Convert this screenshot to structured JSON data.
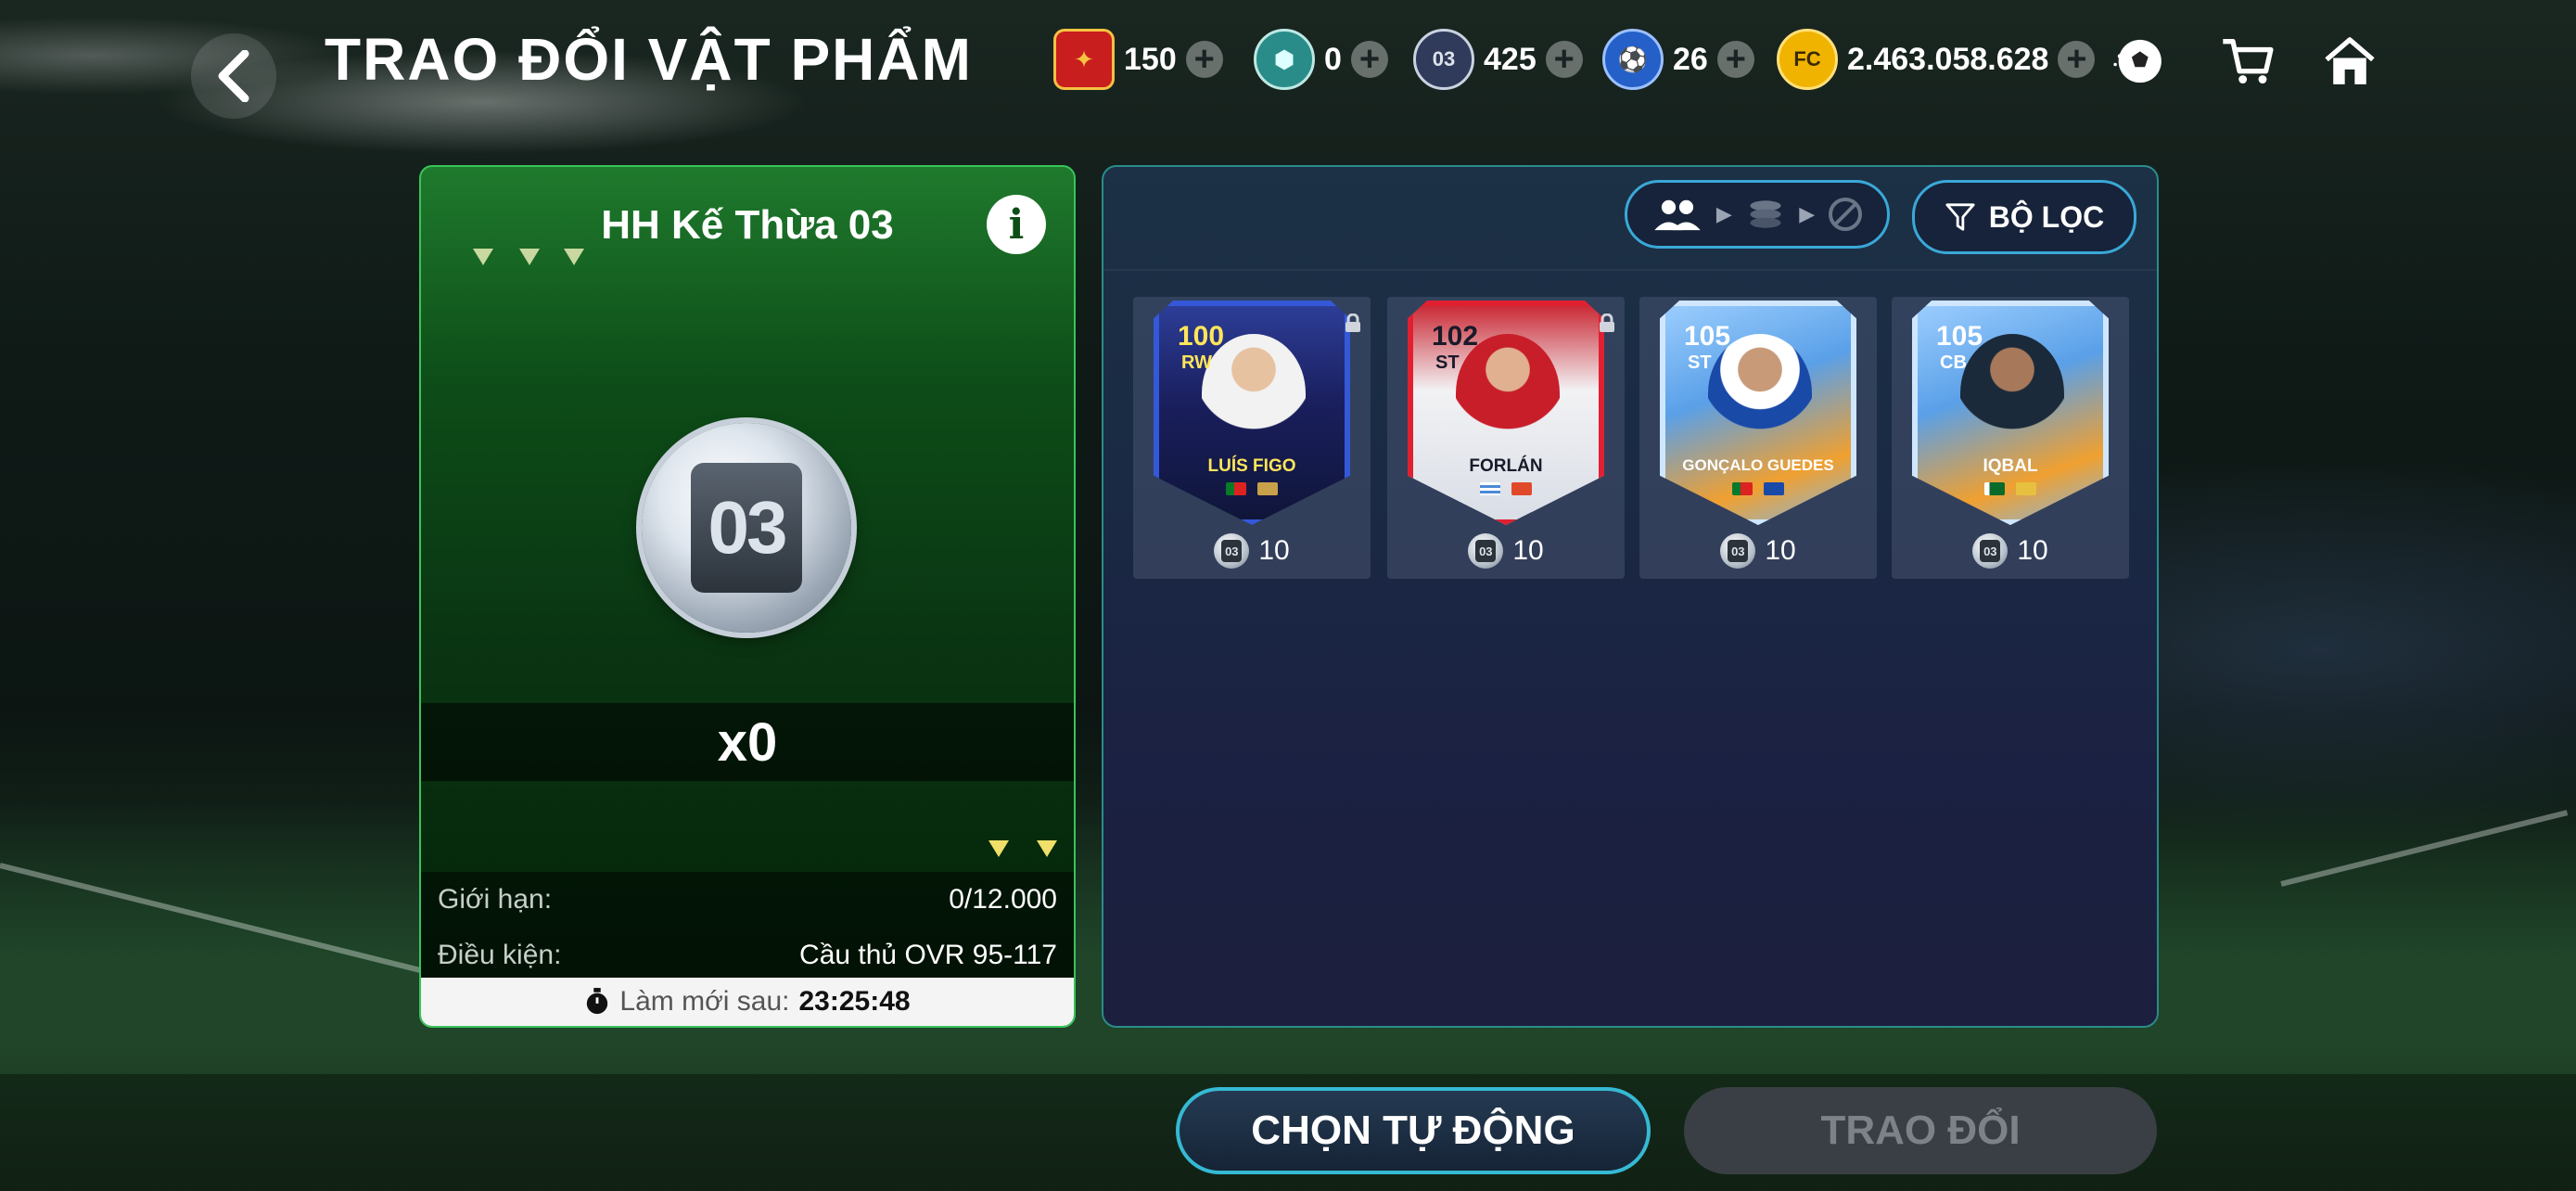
{
  "header": {
    "title": "TRAO ĐỔI VẬT PHẨM",
    "currencies": [
      {
        "icon": "red-token-icon",
        "value": "150"
      },
      {
        "icon": "shield-token-icon",
        "value": "0"
      },
      {
        "icon": "coin-03-icon",
        "value": "425"
      },
      {
        "icon": "player-token-icon",
        "value": "26"
      },
      {
        "icon": "fc-coin-icon",
        "value": "2.463.058.628"
      }
    ]
  },
  "left_panel": {
    "title": "HH Kế Thừa 03",
    "coin_label": "03",
    "quantity": "x0",
    "limit_label": "Giới hạn:",
    "limit_value": "0/12.000",
    "condition_label": "Điều kiện:",
    "condition_value": "Cầu thủ OVR 95-117",
    "refresh_label": "Làm mới sau:",
    "refresh_time": "23:25:48"
  },
  "right_panel": {
    "filter_label": "BỘ LỌC",
    "cards": [
      {
        "name": "LUÍS FIGO",
        "ovr": "100",
        "pos": "RW",
        "coin": "03",
        "cost": "10",
        "locked": true,
        "theme": "blue-dark"
      },
      {
        "name": "FORLÁN",
        "ovr": "102",
        "pos": "ST",
        "coin": "03",
        "cost": "10",
        "locked": true,
        "theme": "red-white"
      },
      {
        "name": "GONÇALO GUEDES",
        "ovr": "105",
        "pos": "ST",
        "coin": "03",
        "cost": "10",
        "locked": false,
        "theme": "light-blue"
      },
      {
        "name": "IQBAL",
        "ovr": "105",
        "pos": "CB",
        "coin": "03",
        "cost": "10",
        "locked": false,
        "theme": "light-blue"
      }
    ]
  },
  "footer": {
    "auto_select": "CHỌN TỰ ĐỘNG",
    "exchange": "TRAO ĐỔI"
  },
  "colors": {
    "accent_teal": "#36b9d4",
    "panel_green": "#0d4d18",
    "gold": "#f0b400"
  }
}
